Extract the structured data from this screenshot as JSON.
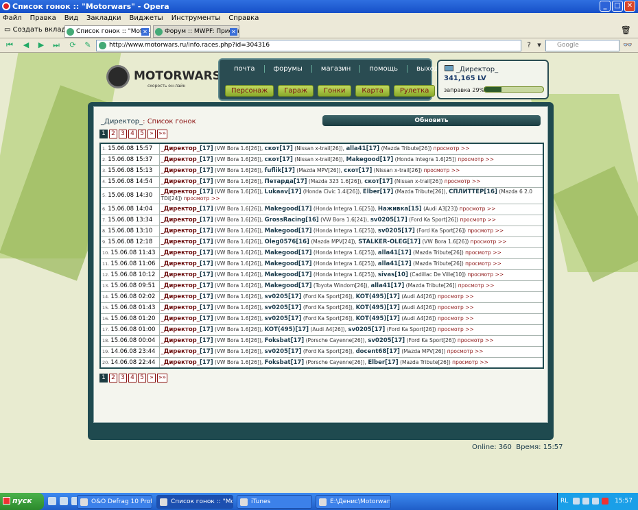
{
  "window": {
    "title": "Список гонок :: \"Motorwars\" - Opera"
  },
  "menu": [
    "Файл",
    "Правка",
    "Вид",
    "Закладки",
    "Виджеты",
    "Инструменты",
    "Справка"
  ],
  "tabs": {
    "new_tab": "Создать вкладку",
    "items": [
      "Список гонок :: \"Motor...",
      "Форум :: MWPF: Приемн..."
    ]
  },
  "address": {
    "url": "http://www.motorwars.ru/info.races.php?id=304316",
    "search_placeholder": "Google"
  },
  "logo": {
    "name": "MOTORWARS.RU",
    "tagline": "скорость он-лайн"
  },
  "nav": {
    "top": [
      "почта",
      "форумы",
      "магазин",
      "помощь",
      "выход"
    ],
    "bottom": [
      "Персонаж",
      "Гараж",
      "Гонки",
      "Карта",
      "Рулетка"
    ]
  },
  "player": {
    "name": "_Директор_",
    "money": "341,165 LV",
    "fuel_label": "заправка 29%",
    "fuel_fraction": 0.29
  },
  "page": {
    "owner": "_Директор_",
    "title": ": Список гонок",
    "refresh_label": "Обновить"
  },
  "pagination": {
    "pages": [
      "1",
      "2",
      "3",
      "4",
      "5"
    ],
    "next": "»",
    "last": "»»",
    "current": "1"
  },
  "races": [
    {
      "n": "1.",
      "date": "15.06.08 15:57",
      "p": [
        [
          "_Директор_",
          "[17]",
          " (VW Bora 1.6[26]), "
        ],
        [
          "скот",
          "[17]",
          " (Nissan x-trail[26]), "
        ],
        [
          "alla41",
          "[17]",
          " (Mazda Tribute[26]) "
        ]
      ],
      "view": "просмотр >>"
    },
    {
      "n": "2.",
      "date": "15.06.08 15:37",
      "p": [
        [
          "_Директор_",
          "[17]",
          " (VW Bora 1.6[26]), "
        ],
        [
          "скот",
          "[17]",
          " (Nissan x-trail[26]), "
        ],
        [
          "Makegood",
          "[17]",
          " (Honda Integra 1.6[25]) "
        ]
      ],
      "view": "просмотр >>"
    },
    {
      "n": "3.",
      "date": "15.06.08 15:13",
      "p": [
        [
          "_Директор_",
          "[17]",
          " (VW Bora 1.6[26]), "
        ],
        [
          "fuflik",
          "[17]",
          " (Mazda MPV[26]), "
        ],
        [
          "скот",
          "[17]",
          " (Nissan x-trail[26]) "
        ]
      ],
      "view": "просмотр >>"
    },
    {
      "n": "4.",
      "date": "15.06.08 14:54",
      "p": [
        [
          "_Директор_",
          "[17]",
          " (VW Bora 1.6[26]), "
        ],
        [
          "Петарда",
          "[17]",
          " (Mazda 323 1.6[26]), "
        ],
        [
          "скот",
          "[17]",
          " (Nissan x-trail[26]) "
        ]
      ],
      "view": "просмотр >>"
    },
    {
      "n": "5.",
      "date": "15.06.08 14:30",
      "tall": true,
      "p": [
        [
          "_Директор_",
          "[17]",
          " (VW Bora 1.6[26]), "
        ],
        [
          "Lukaav",
          "[17]",
          " (Honda Civic 1.4i[26]), "
        ],
        [
          "Elber",
          "[17]",
          " (Mazda Tribute[26]), "
        ],
        [
          "СПЛИТТЕР",
          "[16]",
          " (Mazda 6 2.0 TDi[24]) "
        ]
      ],
      "view": "просмотр >>"
    },
    {
      "n": "6.",
      "date": "15.06.08 14:04",
      "p": [
        [
          "_Директор_",
          "[17]",
          " (VW Bora 1.6[26]), "
        ],
        [
          "Makegood",
          "[17]",
          " (Honda Integra 1.6[25]), "
        ],
        [
          "Наживка",
          "[15]",
          " (Audi A3[23]) "
        ]
      ],
      "view": "просмотр >>"
    },
    {
      "n": "7.",
      "date": "15.06.08 13:34",
      "p": [
        [
          "_Директор_",
          "[17]",
          " (VW Bora 1.6[26]), "
        ],
        [
          "GrossRacing",
          "[16]",
          " (VW Bora 1.6[24]), "
        ],
        [
          "sv0205",
          "[17]",
          " (Ford Ka Sport[26]) "
        ]
      ],
      "view": "просмотр >>"
    },
    {
      "n": "8.",
      "date": "15.06.08 13:10",
      "p": [
        [
          "_Директор_",
          "[17]",
          " (VW Bora 1.6[26]), "
        ],
        [
          "Makegood",
          "[17]",
          " (Honda Integra 1.6[25]), "
        ],
        [
          "sv0205",
          "[17]",
          " (Ford Ka Sport[26]) "
        ]
      ],
      "view": "просмотр >>"
    },
    {
      "n": "9.",
      "date": "15.06.08 12:18",
      "p": [
        [
          "_Директор_",
          "[17]",
          " (VW Bora 1.6[26]), "
        ],
        [
          "Oleg0576",
          "[16]",
          " (Mazda MPV[24]), "
        ],
        [
          "STALKER-OLEG",
          "[17]",
          " (VW Bora 1.6[26]) "
        ]
      ],
      "view": "просмотр >>"
    },
    {
      "n": "10.",
      "date": "15.06.08 11:43",
      "p": [
        [
          "_Директор_",
          "[17]",
          " (VW Bora 1.6[26]), "
        ],
        [
          "Makegood",
          "[17]",
          " (Honda Integra 1.6[25]), "
        ],
        [
          "alla41",
          "[17]",
          " (Mazda Tribute[26]) "
        ]
      ],
      "view": "просмотр >>"
    },
    {
      "n": "11.",
      "date": "15.06.08 11:06",
      "p": [
        [
          "_Директор_",
          "[17]",
          " (VW Bora 1.6[26]), "
        ],
        [
          "Makegood",
          "[17]",
          " (Honda Integra 1.6[25]), "
        ],
        [
          "alla41",
          "[17]",
          " (Mazda Tribute[26]) "
        ]
      ],
      "view": "просмотр >>"
    },
    {
      "n": "12.",
      "date": "15.06.08 10:12",
      "p": [
        [
          "_Директор_",
          "[17]",
          " (VW Bora 1.6[26]), "
        ],
        [
          "Makegood",
          "[17]",
          " (Honda Integra 1.6[25]), "
        ],
        [
          "sivas",
          "[10]",
          " (Cadillac De Ville[10]) "
        ]
      ],
      "view": "просмотр >>"
    },
    {
      "n": "13.",
      "date": "15.06.08 09:51",
      "p": [
        [
          "_Директор_",
          "[17]",
          " (VW Bora 1.6[26]), "
        ],
        [
          "Makegood",
          "[17]",
          " (Toyota Windom[26]), "
        ],
        [
          "alla41",
          "[17]",
          " (Mazda Tribute[26]) "
        ]
      ],
      "view": "просмотр >>"
    },
    {
      "n": "14.",
      "date": "15.06.08 02:02",
      "p": [
        [
          "_Директор_",
          "[17]",
          " (VW Bora 1.6[26]), "
        ],
        [
          "sv0205",
          "[17]",
          " (Ford Ka Sport[26]), "
        ],
        [
          "KOT(495)",
          "[17]",
          " (Audi A4[26]) "
        ]
      ],
      "view": "просмотр >>"
    },
    {
      "n": "15.",
      "date": "15.06.08 01:43",
      "p": [
        [
          "_Директор_",
          "[17]",
          " (VW Bora 1.6[26]), "
        ],
        [
          "sv0205",
          "[17]",
          " (Ford Ka Sport[26]), "
        ],
        [
          "KOT(495)",
          "[17]",
          " (Audi A4[26]) "
        ]
      ],
      "view": "просмотр >>"
    },
    {
      "n": "16.",
      "date": "15.06.08 01:20",
      "p": [
        [
          "_Директор_",
          "[17]",
          " (VW Bora 1.6[26]), "
        ],
        [
          "sv0205",
          "[17]",
          " (Ford Ka Sport[26]), "
        ],
        [
          "KOT(495)",
          "[17]",
          " (Audi A4[26]) "
        ]
      ],
      "view": "просмотр >>"
    },
    {
      "n": "17.",
      "date": "15.06.08 01:00",
      "p": [
        [
          "_Директор_",
          "[17]",
          " (VW Bora 1.6[26]), "
        ],
        [
          "KOT(495)",
          "[17]",
          " (Audi A4[26]), "
        ],
        [
          "sv0205",
          "[17]",
          " (Ford Ka Sport[26]) "
        ]
      ],
      "view": "просмотр >>"
    },
    {
      "n": "18.",
      "date": "15.06.08 00:04",
      "p": [
        [
          "_Директор_",
          "[17]",
          " (VW Bora 1.6[26]), "
        ],
        [
          "Foksbat",
          "[17]",
          " (Porsche Cayenne[26]), "
        ],
        [
          "sv0205",
          "[17]",
          " (Ford Ka Sport[26]) "
        ]
      ],
      "view": "просмотр >>"
    },
    {
      "n": "19.",
      "date": "14.06.08 23:44",
      "p": [
        [
          "_Директор_",
          "[17]",
          " (VW Bora 1.6[26]), "
        ],
        [
          "sv0205",
          "[17]",
          " (Ford Ka Sport[26]), "
        ],
        [
          "docent68",
          "[17]",
          " (Mazda MPV[26]) "
        ]
      ],
      "view": "просмотр >>"
    },
    {
      "n": "20.",
      "date": "14.06.08 22:44",
      "p": [
        [
          "_Директор_",
          "[17]",
          " (VW Bora 1.6[26]), "
        ],
        [
          "Foksbat",
          "[17]",
          " (Porsche Cayenne[26]), "
        ],
        [
          "Elber",
          "[17]",
          " (Mazda Tribute[26]) "
        ]
      ],
      "view": "просмотр >>"
    }
  ],
  "footer": {
    "online": "Online: 360",
    "time": "Время: 15:57"
  },
  "taskbar": {
    "start": "пуск",
    "items": [
      "O&O Defrag 10 Profe...",
      "Список гонок :: \"Mot...",
      "iTunes",
      "E:\\Денис\\Motorwars\\..."
    ],
    "lang": "RL",
    "clock": "15:57"
  },
  "colors": {
    "panel": "#1f4a4f",
    "accent_red": "#8a1010",
    "nav_green": "#a8c048"
  }
}
